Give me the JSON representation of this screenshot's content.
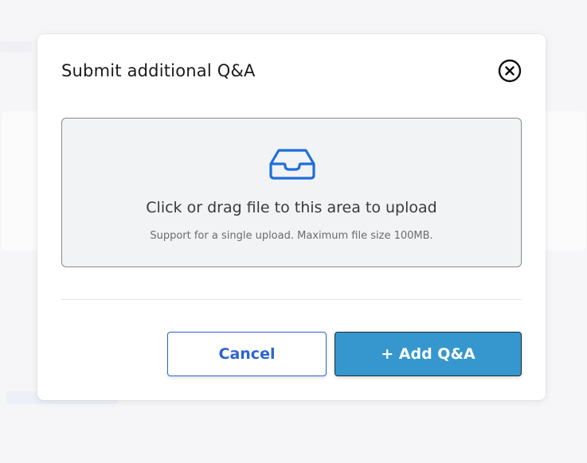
{
  "modal": {
    "title": "Submit additional Q&A",
    "close_icon": "close-circle-icon"
  },
  "upload": {
    "icon": "inbox-icon",
    "title": "Click or drag file to this area to upload",
    "hint": "Support for a single upload. Maximum file size 100MB."
  },
  "actions": {
    "cancel_label": "Cancel",
    "add_label": "+ Add Q&A"
  },
  "colors": {
    "accent_blue": "#2b64d6",
    "primary_button": "#3597cd",
    "icon_blue": "#1f6fd9"
  }
}
